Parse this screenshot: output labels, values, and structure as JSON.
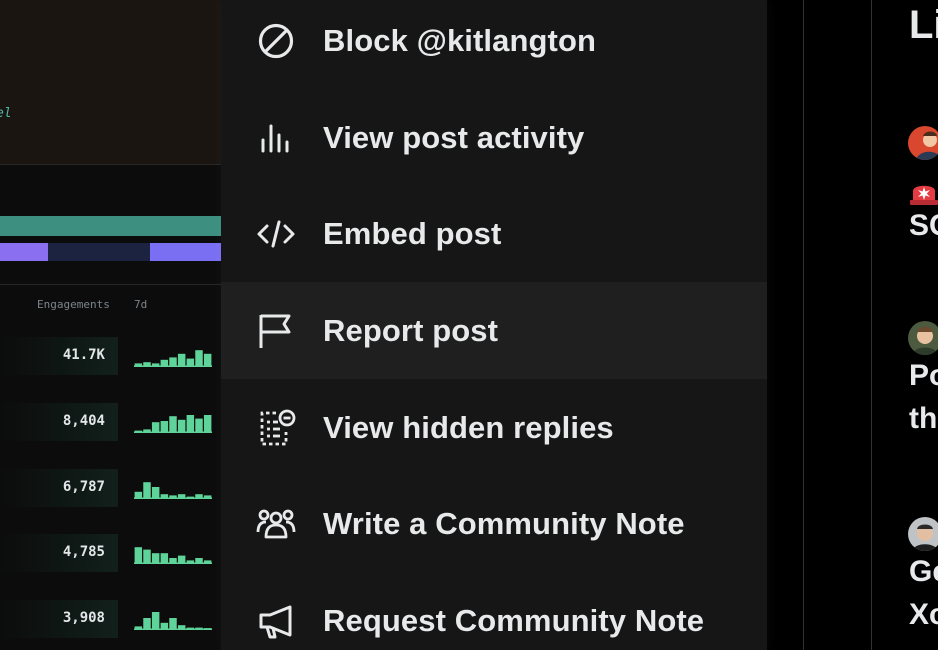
{
  "post_image": {
    "top_note": "el",
    "columns": {
      "engagements_label": "Engagements",
      "period_label": "7d"
    },
    "rows": [
      {
        "value": "41.7K",
        "spark": [
          0.15,
          0.2,
          0.15,
          0.3,
          0.4,
          0.55,
          0.35,
          0.7,
          0.55
        ]
      },
      {
        "value": "8,404",
        "spark": [
          0.1,
          0.15,
          0.45,
          0.5,
          0.7,
          0.55,
          0.75,
          0.6,
          0.75
        ]
      },
      {
        "value": "6,787",
        "spark": [
          0.3,
          0.7,
          0.5,
          0.2,
          0.15,
          0.2,
          0.1,
          0.2,
          0.15
        ]
      },
      {
        "value": "4,785",
        "spark": [
          0.7,
          0.6,
          0.45,
          0.45,
          0.25,
          0.35,
          0.15,
          0.25,
          0.15
        ]
      },
      {
        "value": "3,908",
        "spark": [
          0.15,
          0.5,
          0.75,
          0.3,
          0.5,
          0.2,
          0.1,
          0.1,
          0.08
        ]
      }
    ],
    "colors": {
      "teal": "#3d8f7f",
      "purple": "#8a6ff0",
      "spark": "#5fd49a"
    }
  },
  "menu": {
    "items": [
      {
        "id": "block",
        "label": "Block @kitlangton",
        "icon": "block-icon"
      },
      {
        "id": "activity",
        "label": "View post activity",
        "icon": "bar-chart-icon"
      },
      {
        "id": "embed",
        "label": "Embed post",
        "icon": "code-icon"
      },
      {
        "id": "report",
        "label": "Report post",
        "icon": "flag-icon"
      },
      {
        "id": "hidden",
        "label": "View hidden replies",
        "icon": "hidden-replies-icon"
      },
      {
        "id": "write-note",
        "label": "Write a Community Note",
        "icon": "people-icon"
      },
      {
        "id": "request-note",
        "label": "Request Community Note",
        "icon": "megaphone-icon"
      }
    ],
    "hovered": "report"
  },
  "sidebar": {
    "title": "Li",
    "items": [
      {
        "line1": "SC"
      },
      {
        "line1": "Po",
        "line2": "th"
      },
      {
        "line1": "Ge",
        "line2": "Xc"
      }
    ]
  }
}
